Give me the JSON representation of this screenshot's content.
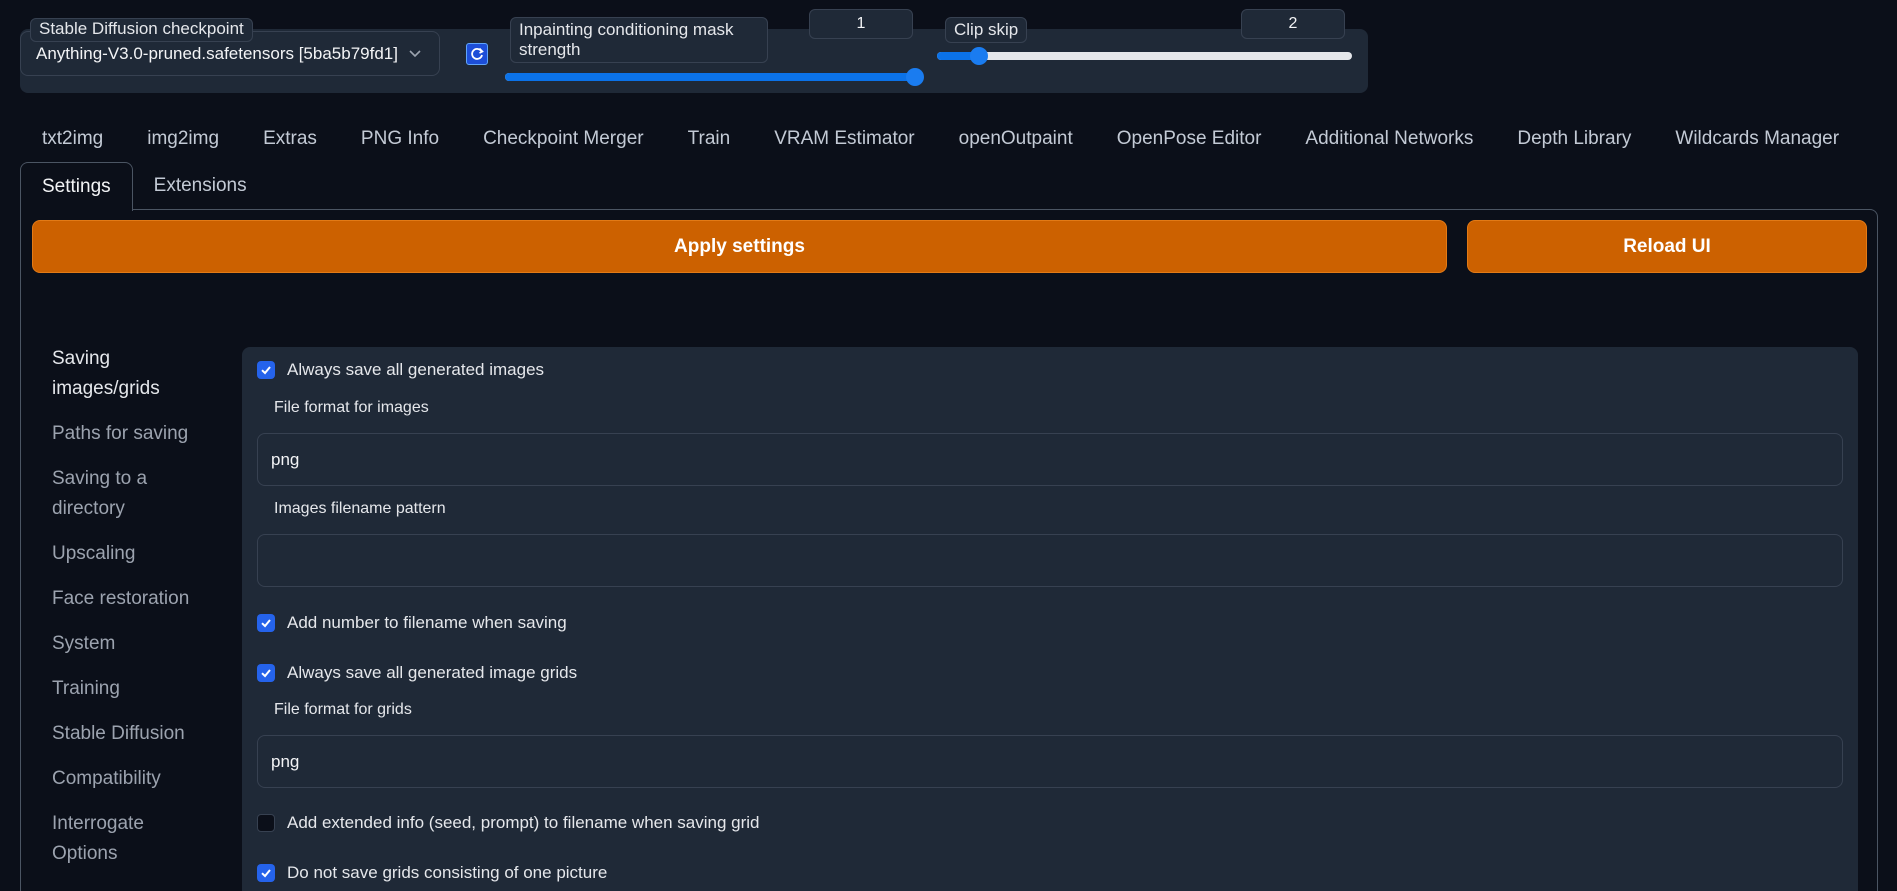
{
  "quicksettings": {
    "checkpoint_label": "Stable Diffusion checkpoint",
    "checkpoint_value": "Anything-V3.0-pruned.safetensors [5ba5b79fd1]",
    "mask_label": "Inpainting conditioning mask strength",
    "mask_value": "1",
    "mask_level": 1.0,
    "clip_label": "Clip skip",
    "clip_value": "2",
    "clip_level": 0.1,
    "accent_color": "#0b72e8"
  },
  "tabs": {
    "row1": [
      "txt2img",
      "img2img",
      "Extras",
      "PNG Info",
      "Checkpoint Merger",
      "Train",
      "VRAM Estimator",
      "openOutpaint",
      "OpenPose Editor",
      "Additional Networks",
      "Depth Library",
      "Wildcards Manager"
    ],
    "settings": "Settings",
    "extensions": "Extensions"
  },
  "buttons": {
    "apply": "Apply settings",
    "reload": "Reload UI",
    "color": "#cc6100"
  },
  "sidebar": {
    "items": [
      "Saving images/grids",
      "Paths for saving",
      "Saving to a directory",
      "Upscaling",
      "Face restoration",
      "System",
      "Training",
      "Stable Diffusion",
      "Compatibility",
      "Interrogate Options"
    ]
  },
  "settings": {
    "always_save_images": "Always save all generated images",
    "file_format_images_label": "File format for images",
    "file_format_images_value": "png",
    "filename_pattern_label": "Images filename pattern",
    "filename_pattern_value": "",
    "add_number": "Add number to filename when saving",
    "always_save_grids": "Always save all generated image grids",
    "file_format_grids_label": "File format for grids",
    "file_format_grids_value": "png",
    "add_extended_info": "Add extended info (seed, prompt) to filename when saving grid",
    "no_single_grids": "Do not save grids consisting of one picture"
  }
}
